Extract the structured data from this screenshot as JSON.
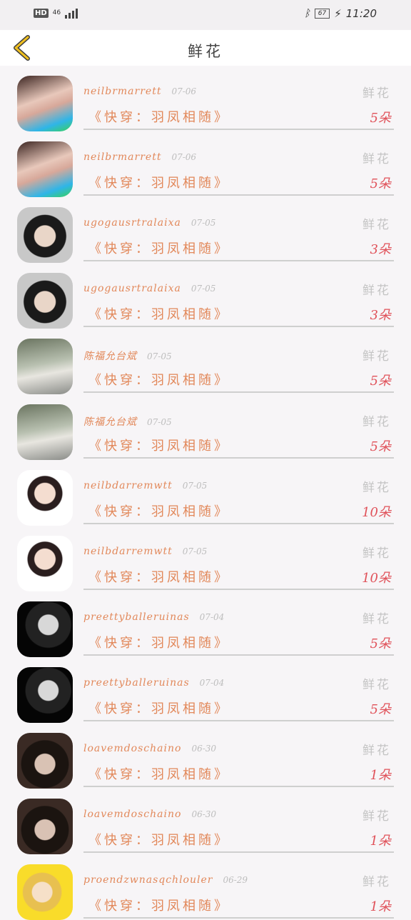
{
  "status_bar": {
    "left": "HD",
    "network": "46",
    "battery": "67",
    "time": "11:20"
  },
  "header": {
    "title": "鲜花"
  },
  "records": [
    {
      "user": "neilbrmarrett",
      "date": "07-06",
      "kind": "鲜花",
      "book": "《快穿：羽凤相随》",
      "count": "5朵",
      "avatar": "av-a"
    },
    {
      "user": "neilbrmarrett",
      "date": "07-06",
      "kind": "鲜花",
      "book": "《快穿：羽凤相随》",
      "count": "5朵",
      "avatar": "av-a"
    },
    {
      "user": "ugogausrtralaixa",
      "date": "07-05",
      "kind": "鲜花",
      "book": "《快穿：羽凤相随》",
      "count": "3朵",
      "avatar": "av-b"
    },
    {
      "user": "ugogausrtralaixa",
      "date": "07-05",
      "kind": "鲜花",
      "book": "《快穿：羽凤相随》",
      "count": "3朵",
      "avatar": "av-b"
    },
    {
      "user": "陈福允台斌",
      "date": "07-05",
      "kind": "鲜花",
      "book": "《快穿：羽凤相随》",
      "count": "5朵",
      "avatar": "av-c"
    },
    {
      "user": "陈福允台斌",
      "date": "07-05",
      "kind": "鲜花",
      "book": "《快穿：羽凤相随》",
      "count": "5朵",
      "avatar": "av-c"
    },
    {
      "user": "neilbdarremwtt",
      "date": "07-05",
      "kind": "鲜花",
      "book": "《快穿：羽凤相随》",
      "count": "10朵",
      "avatar": "av-d"
    },
    {
      "user": "neilbdarremwtt",
      "date": "07-05",
      "kind": "鲜花",
      "book": "《快穿：羽凤相随》",
      "count": "10朵",
      "avatar": "av-d"
    },
    {
      "user": "preettyballeruinas",
      "date": "07-04",
      "kind": "鲜花",
      "book": "《快穿：羽凤相随》",
      "count": "5朵",
      "avatar": "av-e"
    },
    {
      "user": "preettyballeruinas",
      "date": "07-04",
      "kind": "鲜花",
      "book": "《快穿：羽凤相随》",
      "count": "5朵",
      "avatar": "av-e"
    },
    {
      "user": "loavemdoschaino",
      "date": "06-30",
      "kind": "鲜花",
      "book": "《快穿：羽凤相随》",
      "count": "1朵",
      "avatar": "av-f"
    },
    {
      "user": "loavemdoschaino",
      "date": "06-30",
      "kind": "鲜花",
      "book": "《快穿：羽凤相随》",
      "count": "1朵",
      "avatar": "av-f"
    },
    {
      "user": "proendzwnasqchlouler",
      "date": "06-29",
      "kind": "鲜花",
      "book": "《快穿：羽凤相随》",
      "count": "1朵",
      "avatar": "av-g"
    }
  ]
}
